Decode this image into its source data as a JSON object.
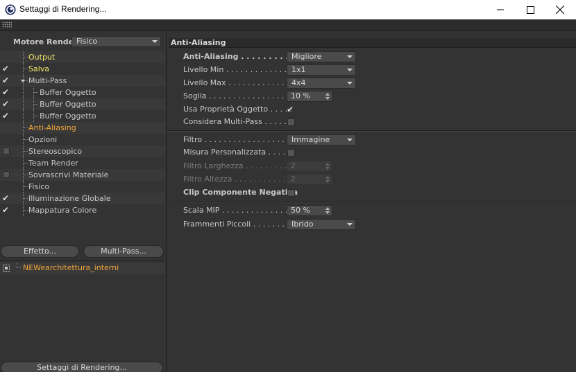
{
  "window": {
    "title": "Settaggi di Rendering...",
    "icons": {
      "app": "cinema4d-icon",
      "minimize": "minimize-icon",
      "maximize": "maximize-icon",
      "close": "close-icon"
    }
  },
  "left": {
    "engine_label": "Motore Render",
    "engine_value": "Fisico",
    "tree": [
      {
        "label": "Output",
        "checked": false,
        "color": "yellow"
      },
      {
        "label": "Salva",
        "checked": true,
        "color": "yellow"
      },
      {
        "label": "Multi-Pass",
        "checked": true,
        "color": "normal"
      },
      {
        "label": "Buffer Oggetto",
        "checked": true,
        "color": "normal"
      },
      {
        "label": "Buffer Oggetto",
        "checked": true,
        "color": "normal"
      },
      {
        "label": "Buffer Oggetto",
        "checked": true,
        "color": "normal"
      },
      {
        "label": "Anti-Aliasing",
        "checked": false,
        "color": "orange"
      },
      {
        "label": "Opzioni",
        "checked": false,
        "color": "normal"
      },
      {
        "label": "Stereoscopico",
        "checked": false,
        "color": "normal"
      },
      {
        "label": "Team Render",
        "checked": false,
        "color": "normal"
      },
      {
        "label": "Sovrascrivi Materiale",
        "checked": false,
        "color": "normal"
      },
      {
        "label": "Fisico",
        "checked": false,
        "color": "normal"
      },
      {
        "label": "Illuminazione Globale",
        "checked": true,
        "color": "normal"
      },
      {
        "label": "Mappatura Colore",
        "checked": true,
        "color": "normal"
      }
    ],
    "effect_button": "Effetto...",
    "multipass_button": "Multi-Pass...",
    "render_setting_name": "NEWearchitettura_interni",
    "bottom_button": "Settaggi di Rendering..."
  },
  "right": {
    "header": "Anti-Aliasing",
    "anti_aliasing": {
      "label": "Anti-Aliasing",
      "value": "Migliore"
    },
    "min_level": {
      "label": "Livello Min",
      "value": "1x1"
    },
    "max_level": {
      "label": "Livello Max",
      "value": "4x4"
    },
    "threshold": {
      "label": "Soglia",
      "value": "10 %"
    },
    "use_object_props": {
      "label": "Usa Proprietà Oggetto",
      "checked": true
    },
    "consider_multipass": {
      "label": "Considera Multi-Pass",
      "checked": false
    },
    "filter": {
      "label": "Filtro",
      "value": "Immagine"
    },
    "custom_size": {
      "label": "Misura Personalizzata",
      "checked": false
    },
    "filter_width": {
      "label": "Filtro Larghezza",
      "value": "2"
    },
    "filter_height": {
      "label": "Filtro Altezza",
      "value": "2"
    },
    "clip_negative": {
      "label": "Clip Componente Negativa",
      "checked": false
    },
    "mip_scale": {
      "label": "Scala MIP",
      "value": "50 %"
    },
    "micro_fragments": {
      "label": "Frammenti Piccoli",
      "value": "Ibrido"
    }
  },
  "colors": {
    "background": "#333333",
    "highlight_yellow": "#f4e66a",
    "highlight_orange": "#f2a63a"
  }
}
